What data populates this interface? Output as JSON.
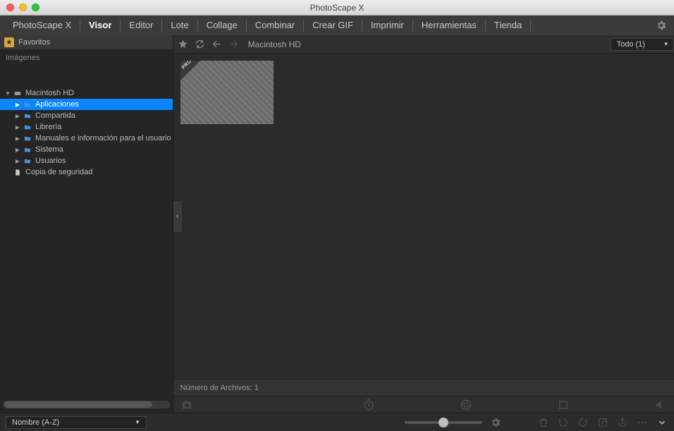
{
  "window": {
    "title": "PhotoScape X"
  },
  "menubar": {
    "items": [
      "PhotoScape X",
      "Visor",
      "Editor",
      "Lote",
      "Collage",
      "Combinar",
      "Crear GIF",
      "Imprimir",
      "Herramientas",
      "Tienda"
    ],
    "active_index": 1
  },
  "sidebar": {
    "favorites_label": "Favoritos",
    "images_label": "Imágenes",
    "tree": [
      {
        "label": "Macintosh HD",
        "type": "drive",
        "depth": 0,
        "expanded": true,
        "selected": false
      },
      {
        "label": "Aplicaciones",
        "type": "folder",
        "depth": 1,
        "expanded": false,
        "selected": true
      },
      {
        "label": "Compartida",
        "type": "folder",
        "depth": 1,
        "expanded": false,
        "selected": false
      },
      {
        "label": "Librería",
        "type": "folder",
        "depth": 1,
        "expanded": false,
        "selected": false
      },
      {
        "label": "Manuales e información para el usuario",
        "type": "folder",
        "depth": 1,
        "expanded": false,
        "selected": false
      },
      {
        "label": "Sistema",
        "type": "folder",
        "depth": 1,
        "expanded": false,
        "selected": false
      },
      {
        "label": "Usuarios",
        "type": "folder",
        "depth": 1,
        "expanded": false,
        "selected": false
      },
      {
        "label": "Copia de seguridad",
        "type": "doc",
        "depth": 0,
        "expanded": null,
        "selected": false
      }
    ]
  },
  "toolbar": {
    "breadcrumb": "Macintosh HD",
    "filter_label": "Todo (1)"
  },
  "thumbnails": {
    "pro_badge": "PRO"
  },
  "status": {
    "filecount_label": "Número de Archivos: 1"
  },
  "bottombar": {
    "sort_label": "Nombre (A-Z)"
  }
}
